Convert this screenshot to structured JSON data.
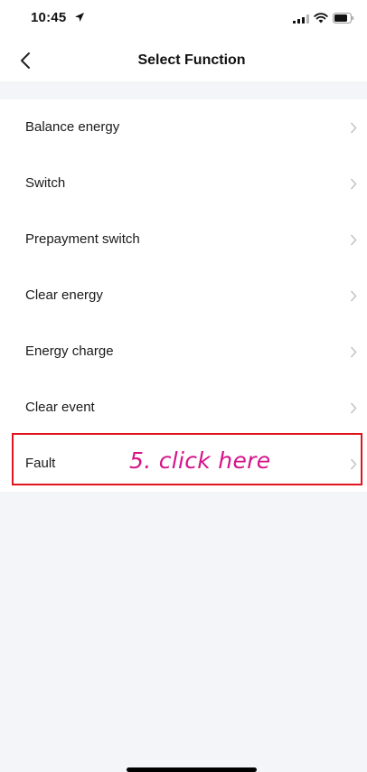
{
  "status_bar": {
    "time": "10:45",
    "icons": [
      "location-arrow-icon",
      "cellular-signal-icon",
      "wifi-icon",
      "battery-icon"
    ]
  },
  "nav": {
    "back_icon": "chevron-left-icon",
    "title": "Select Function"
  },
  "functions": [
    {
      "label": "Balance energy"
    },
    {
      "label": "Switch"
    },
    {
      "label": "Prepayment switch"
    },
    {
      "label": "Clear energy"
    },
    {
      "label": "Energy charge"
    },
    {
      "label": "Clear event"
    },
    {
      "label": "Fault"
    }
  ],
  "annotation": {
    "text": "5. click here",
    "box_color": "#e0141e",
    "text_color": "#d4148a"
  },
  "colors": {
    "background": "#f4f5f8",
    "list_background": "#ffffff",
    "chevron": "#c2c2c6"
  }
}
